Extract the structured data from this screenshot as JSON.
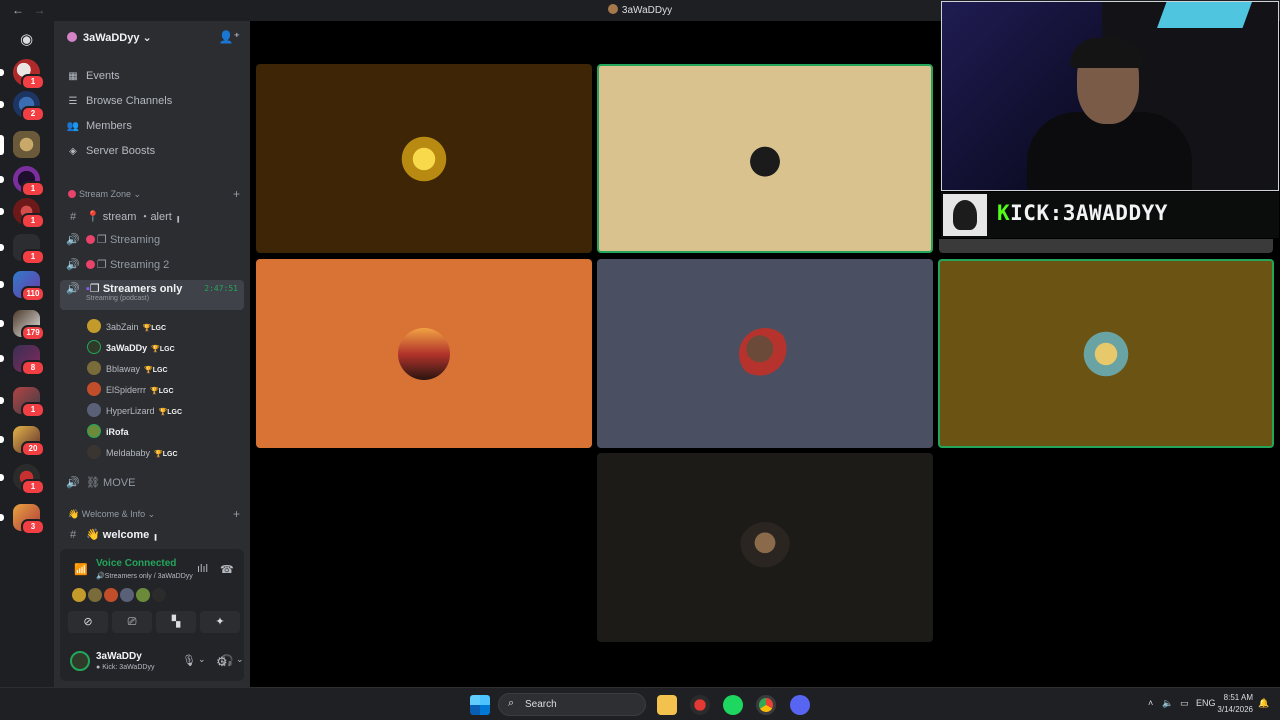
{
  "window": {
    "title": "3aWaDDyy"
  },
  "server": {
    "name": "3aWaDDyy",
    "menu": [
      "Events",
      "Browse Channels",
      "Members",
      "Server Boosts"
    ]
  },
  "guild_badges": [
    "1",
    "2",
    "1",
    "1",
    "1",
    "110",
    "179",
    "8",
    "1",
    "20",
    "1",
    "3"
  ],
  "categories": {
    "stream_zone": "Stream Zone",
    "welcome_info": "Welcome & Info"
  },
  "channels": {
    "stream_alert": "stream ・alert ╻",
    "streaming": "Streaming",
    "streaming2": "Streaming 2",
    "streamers_only": "Streamers only",
    "streamers_only_sub": "Streaming (podcast)",
    "streamers_only_timer": "2:47:51",
    "move": "MOVE",
    "welcome": "welcome ╻"
  },
  "voice_users": [
    {
      "name": "3abZain",
      "tag": "LGC"
    },
    {
      "name": "3aWaDDy",
      "tag": "LGC"
    },
    {
      "name": "Bblaway",
      "tag": "LGC"
    },
    {
      "name": "ElSpiderrr",
      "tag": "LGC"
    },
    {
      "name": "HyperLizard",
      "tag": "LGC"
    },
    {
      "name": "iRofa",
      "tag": ""
    },
    {
      "name": "Meldababy",
      "tag": "LGC"
    }
  ],
  "voice_panel": {
    "status": "Voice Connected",
    "location": "Streamers only / 3aWaDDyy"
  },
  "user": {
    "name": "3aWaDDy",
    "status": "Kick: 3aWaDDyy"
  },
  "stream_overlay": {
    "kick_prefix": "K",
    "kick_text": "ICK:3AWADDYY"
  },
  "colors": {
    "tile_1": "#3d2506",
    "tile_2": "#d9c28e",
    "tile_3": "#d87235",
    "tile_4": "#4a5061",
    "tile_5": "#6b5313",
    "tile_6": "#1c1b17",
    "speaking": "#23a55a",
    "kick_green": "#53fc18"
  },
  "taskbar": {
    "search_placeholder": "Search",
    "language": "ENG",
    "time": "8:51 AM",
    "date": "3/14/2026"
  }
}
